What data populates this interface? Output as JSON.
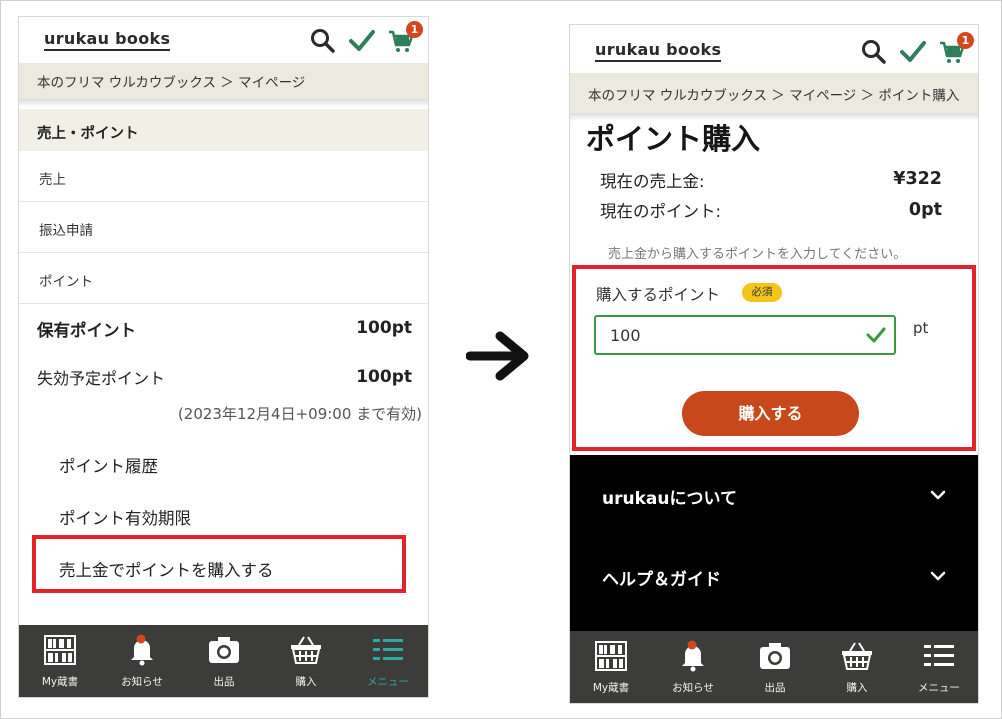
{
  "site": {
    "logo": "urukau books",
    "cart_count": "1"
  },
  "left": {
    "breadcrumb": "本のフリマ ウルカウブックス ＞ マイページ",
    "section_title": "売上・ポイント",
    "menu": [
      "売上",
      "振込申請",
      "ポイント"
    ],
    "held_points_label": "保有ポイント",
    "held_points_value": "100pt",
    "expiring_label": "失効予定ポイント",
    "expiring_value": "100pt",
    "expiring_note": "(2023年12月4日+09:00 まで有効)",
    "links": [
      "ポイント履歴",
      "ポイント有効期限",
      "売上金でポイントを購入する"
    ]
  },
  "right": {
    "breadcrumb": "本のフリマ ウルカウブックス ＞ マイページ ＞ ポイント購入",
    "page_title": "ポイント購入",
    "sales_label": "現在の売上金:",
    "sales_value": "¥322",
    "points_label": "現在のポイント:",
    "points_value": "0pt",
    "hint": "売上金から購入するポイントを入力してください。",
    "buy_label": "購入するポイント",
    "required": "必須",
    "input_value": "100",
    "unit": "pt",
    "buy_button": "購入する",
    "footer": [
      "urukauについて",
      "ヘルプ＆ガイド"
    ]
  },
  "tabs": [
    "My蔵書",
    "お知らせ",
    "出品",
    "購入",
    "メニュー"
  ],
  "colors": {
    "accent_orange": "#c7481b",
    "highlight_red": "#e3232a",
    "check_green": "#2e8b57",
    "teal": "#2fa9a3",
    "tabbar": "#3c3c3a"
  }
}
